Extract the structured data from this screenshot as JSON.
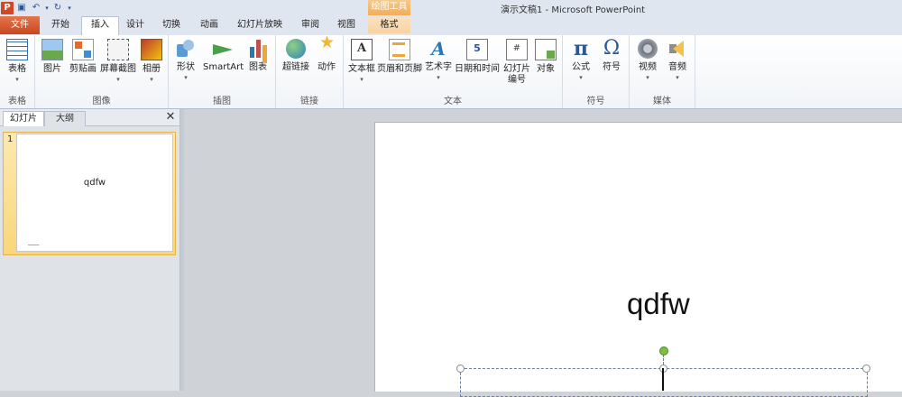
{
  "window": {
    "title": "演示文稿1  -  Microsoft PowerPoint",
    "contextual_header": "绘图工具"
  },
  "tabs": [
    {
      "label": "文件"
    },
    {
      "label": "开始"
    },
    {
      "label": "插入"
    },
    {
      "label": "设计"
    },
    {
      "label": "切换"
    },
    {
      "label": "动画"
    },
    {
      "label": "幻灯片放映"
    },
    {
      "label": "审阅"
    },
    {
      "label": "视图"
    },
    {
      "label": "格式"
    }
  ],
  "ribbon": {
    "groups": [
      {
        "label": "表格",
        "buttons": [
          {
            "label": "表格",
            "icon": "table-icon"
          }
        ]
      },
      {
        "label": "图像",
        "buttons": [
          {
            "label": "图片"
          },
          {
            "label": "剪贴画"
          },
          {
            "label": "屏幕截图"
          },
          {
            "label": "相册"
          }
        ]
      },
      {
        "label": "插图",
        "buttons": [
          {
            "label": "形状"
          },
          {
            "label": "SmartArt"
          },
          {
            "label": "图表"
          }
        ]
      },
      {
        "label": "链接",
        "buttons": [
          {
            "label": "超链接"
          },
          {
            "label": "动作"
          }
        ]
      },
      {
        "label": "文本",
        "buttons": [
          {
            "label": "文本框"
          },
          {
            "label": "页眉和页脚"
          },
          {
            "label": "艺术字"
          },
          {
            "label": "日期和时间"
          },
          {
            "label": "幻灯片",
            "label2": "编号"
          },
          {
            "label": "对象"
          }
        ]
      },
      {
        "label": "符号",
        "buttons": [
          {
            "label": "公式"
          },
          {
            "label": "符号"
          }
        ]
      },
      {
        "label": "媒体",
        "buttons": [
          {
            "label": "视频"
          },
          {
            "label": "音频"
          }
        ]
      }
    ]
  },
  "icons": {
    "textbox_glyph": "A",
    "wordart_glyph": "A",
    "date_glyph": "5",
    "slidenum_glyph": "#",
    "pi_glyph": "π",
    "omega_glyph": "Ω",
    "dropdown": "▾",
    "close": "✕"
  },
  "panel": {
    "tabs": [
      {
        "label": "幻灯片"
      },
      {
        "label": "大纲"
      }
    ],
    "slides": [
      {
        "number": "1",
        "title": "qdfw"
      }
    ]
  },
  "slide": {
    "title": "qdfw"
  },
  "colors": {
    "file_tab": "#c8471f",
    "contextual": "#f3ad5a",
    "rotation_handle": "#7bc043"
  }
}
